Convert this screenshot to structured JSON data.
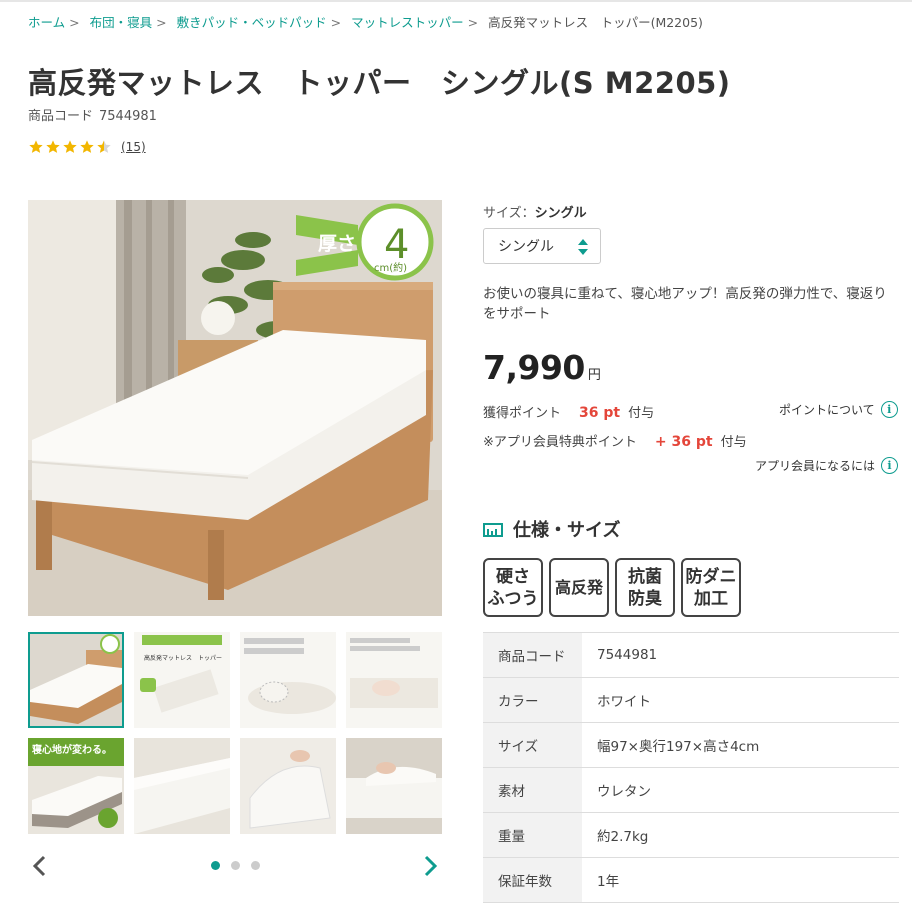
{
  "breadcrumb": {
    "items": [
      "ホーム",
      "布団・寝具",
      "敷きパッド・ベッドパッド",
      "マットレストッパー"
    ],
    "current": "高反発マットレス　トッパー(M2205)"
  },
  "product": {
    "title": "高反発マットレス　トッパー　シングル(S M2205)",
    "code_label": "商品コード",
    "code": "7544981",
    "rating": 4.5,
    "review_count": "(15)"
  },
  "gallery": {
    "main_badge_label": "厚さ",
    "main_badge_value": "4",
    "main_badge_unit": "cm(約)",
    "thumb_texts": {
      "t5_heading": "寝心地が変わる。",
      "t5_sub": "マットレストッパー",
      "t2_heading": "お使いの寝具に重ねて、寝心地アップ！",
      "t2_title": "高反発マットレス　トッパー",
      "t3_heading": "高反発の弾力性で寝返りをサポート",
      "t4_heading": "カバーは抗菌防臭・防ダニ加工の3層ニット生地"
    },
    "dots": 3,
    "active_dot": 0
  },
  "purchase": {
    "size_label": "サイズ：",
    "size_value": "シングル",
    "select_value": "シングル",
    "description": "お使いの寝具に重ねて、寝心地アップ！高反発の弾力性で、寝返りをサポート",
    "price": "7,990",
    "price_unit": "円",
    "points_label": "獲得ポイント",
    "points_value": "36 pt",
    "points_suffix": "付与",
    "points_link": "ポイントについて",
    "app_label": "※アプリ会員特典ポイント",
    "app_value": "+ 36 pt",
    "app_suffix": "付与",
    "app_link": "アプリ会員になるには"
  },
  "specs": {
    "heading": "仕様・サイズ",
    "badges": [
      "硬さ\nふつう",
      "高反発",
      "抗菌\n防臭",
      "防ダニ\n加工"
    ],
    "rows": [
      {
        "label": "商品コード",
        "value": "7544981"
      },
      {
        "label": "カラー",
        "value": "ホワイト"
      },
      {
        "label": "サイズ",
        "value": "幅97×奥行197×高さ4cm"
      },
      {
        "label": "素材",
        "value": "ウレタン"
      },
      {
        "label": "重量",
        "value": "約2.7kg"
      },
      {
        "label": "保証年数",
        "value": "1年"
      }
    ]
  },
  "colors": {
    "accent": "#0e9c8f",
    "points": "#e4463a",
    "star": "#f2b600"
  }
}
